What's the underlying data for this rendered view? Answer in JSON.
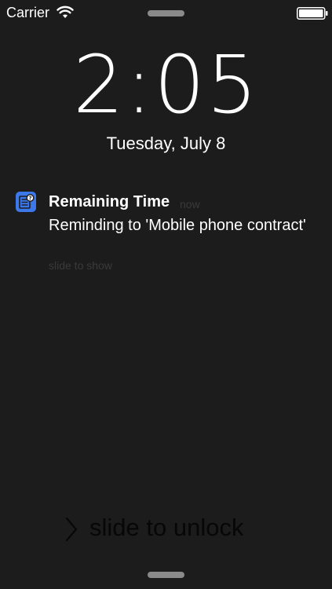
{
  "status_bar": {
    "carrier": "Carrier",
    "wifi_icon": "wifi-icon",
    "battery_icon": "battery-icon"
  },
  "lock_screen": {
    "time": "2:05",
    "date": "Tuesday, July 8"
  },
  "notification": {
    "app_icon": "remaining-time-app-icon",
    "title": "Remaining Time",
    "time": "now",
    "body": "Reminding to 'Mobile phone contract'",
    "hint": "slide to show"
  },
  "unlock": {
    "chevron_icon": "chevron-right-icon",
    "label": "slide to unlock"
  },
  "colors": {
    "background": "#1c1c1c",
    "text": "#ffffff",
    "dim_text": "#3a3a3a",
    "app_icon_blue": "#3d78ea"
  }
}
